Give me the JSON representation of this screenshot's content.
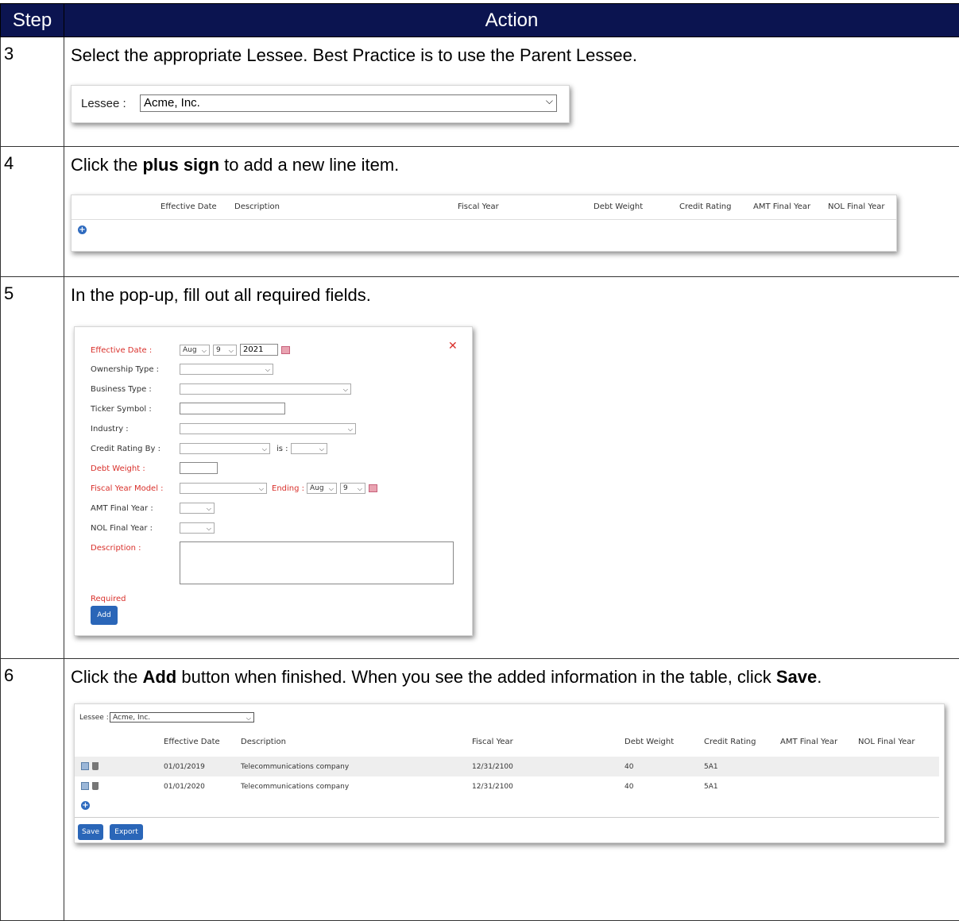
{
  "table": {
    "header_step": "Step",
    "header_action": "Action"
  },
  "steps": [
    {
      "num": "3",
      "text": "Select the appropriate Lessee. Best Practice is to use the Parent Lessee.",
      "lessee_label": "Lessee :",
      "lessee_value": "Acme, Inc."
    },
    {
      "num": "4",
      "text_before": "Click the ",
      "text_bold": "plus sign",
      "text_after": " to add a new line item.",
      "columns": [
        "Effective Date",
        "Description",
        "Fiscal Year",
        "Debt Weight",
        "Credit Rating",
        "AMT Final Year",
        "NOL Final Year"
      ]
    },
    {
      "num": "5",
      "text": "In the pop-up, fill out all required fields.",
      "popup": {
        "effective_date_label": "Effective Date :",
        "month": "Aug",
        "day": "9",
        "year": "2021",
        "ownership_type_label": "Ownership Type :",
        "business_type_label": "Business Type :",
        "ticker_symbol_label": "Ticker Symbol :",
        "industry_label": "Industry :",
        "credit_rating_by_label": "Credit Rating By :",
        "is_label": "is :",
        "debt_weight_label": "Debt Weight :",
        "fiscal_year_model_label": "Fiscal Year Model :",
        "ending_label": "Ending :",
        "ending_month": "Aug",
        "ending_day": "9",
        "amt_final_year_label": "AMT Final Year :",
        "nol_final_year_label": "NOL Final Year :",
        "description_label": "Description :",
        "required_text": "Required",
        "add_button": "Add",
        "close_glyph": "✕"
      }
    },
    {
      "num": "6",
      "text_1": "Click the ",
      "text_bold_1": "Add",
      "text_2": " button when finished. When you see the added information in the table, click ",
      "text_bold_2": "Save",
      "text_3": ".",
      "lessee_label": "Lessee :",
      "lessee_value": "Acme, Inc.",
      "columns": [
        "Effective Date",
        "Description",
        "Fiscal Year",
        "Debt Weight",
        "Credit Rating",
        "AMT Final Year",
        "NOL Final Year"
      ],
      "rows": [
        {
          "effective_date": "01/01/2019",
          "description": "Telecommunications company",
          "fiscal_year": "12/31/2100",
          "debt_weight": "40",
          "credit_rating": "5A1"
        },
        {
          "effective_date": "01/01/2020",
          "description": "Telecommunications company",
          "fiscal_year": "12/31/2100",
          "debt_weight": "40",
          "credit_rating": "5A1"
        }
      ],
      "save_button": "Save",
      "export_button": "Export"
    }
  ],
  "icons": {
    "chevron": "chevron-down-icon",
    "plus": "plus-circle-icon",
    "calendar": "calendar-icon",
    "edit": "edit-icon",
    "trash": "trash-icon"
  },
  "colors": {
    "header_bg": "#0b1450",
    "required_red": "#d9302b",
    "button_blue": "#2a66b8"
  }
}
